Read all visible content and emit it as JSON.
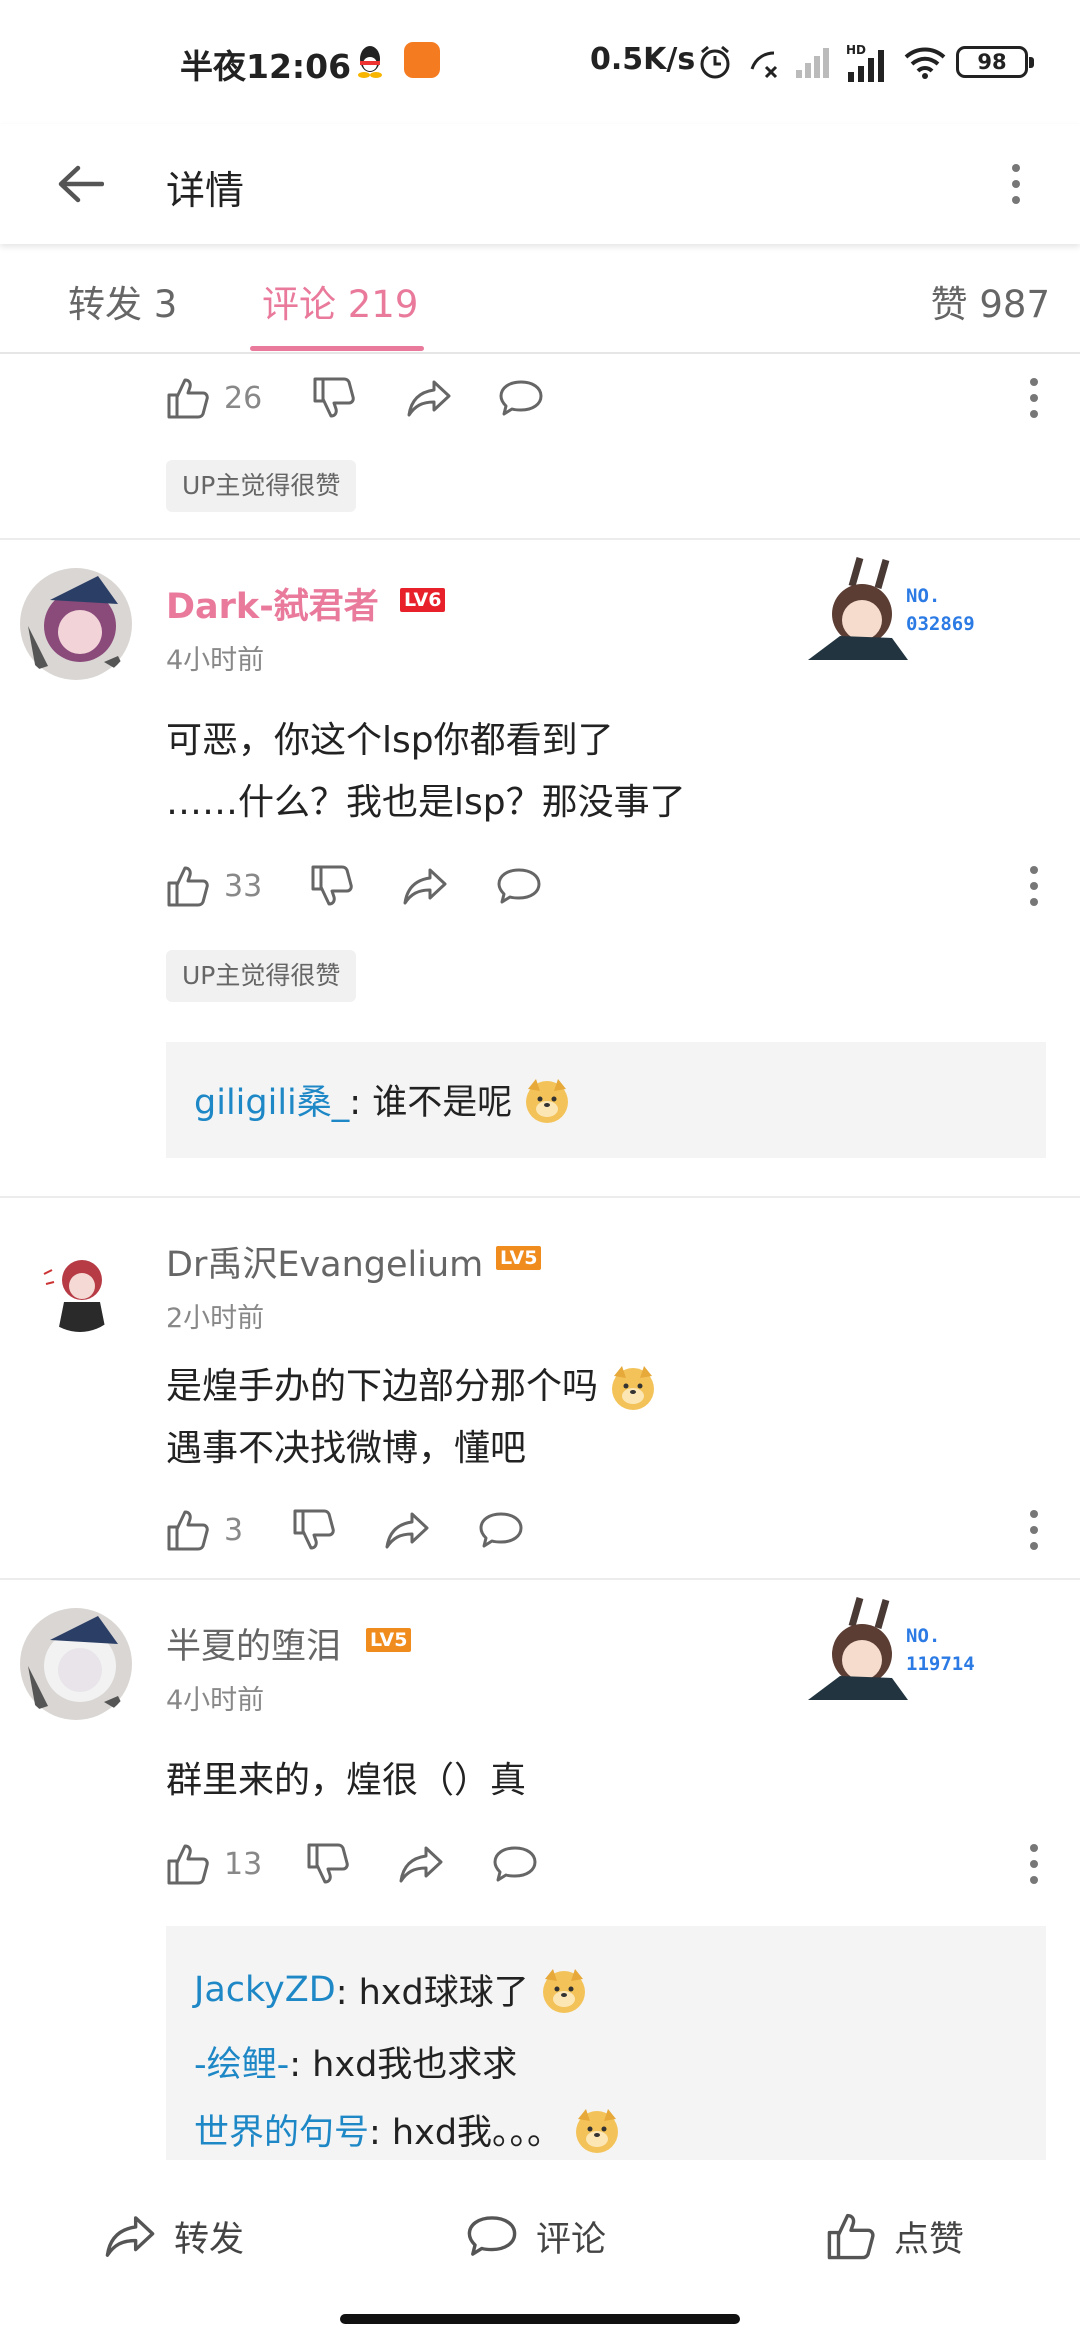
{
  "status_bar": {
    "time": "半夜12:06",
    "net_speed": "0.5K/s",
    "battery": "98",
    "icons": [
      "qq-icon",
      "app-icon",
      "alarm-icon",
      "call-off-icon",
      "signal-icon",
      "hd-signal-icon",
      "wifi-icon",
      "battery-icon"
    ]
  },
  "header": {
    "title": "详情"
  },
  "tabs": {
    "forward": "转发 3",
    "comment": "评论 219",
    "like": "赞 987"
  },
  "colors": {
    "accent_pink": "#e97a9c",
    "link_blue": "#1e88c7",
    "level_red": "#e8202a",
    "level_orange": "#f08c1e"
  },
  "top_partial": {
    "likes": "26",
    "up_liked": "UP主觉得很赞"
  },
  "comments": [
    {
      "user": "Dark-弑君者",
      "level": "LV6",
      "time": "4小时前",
      "badge_no": "NO.",
      "badge_id": "032869",
      "text_lines": [
        "可恶，你这个lsp你都看到了",
        "……什么？我也是lsp？那没事了"
      ],
      "likes": "33",
      "up_liked": "UP主觉得很赞",
      "replies": [
        {
          "name": "giligili桑_",
          "text": ": 谁不是呢"
        }
      ]
    },
    {
      "user": "Dr禹沢Evangelium",
      "level": "LV5",
      "time": "2小时前",
      "text_lines": [
        "是煌手办的下边部分那个吗",
        "遇事不决找微博，懂吧"
      ],
      "likes": "3"
    },
    {
      "user": "半夏的堕泪",
      "level": "LV5",
      "time": "4小时前",
      "badge_no": "NO.",
      "badge_id": "119714",
      "text_lines": [
        "群里来的，煌很（）真"
      ],
      "likes": "13",
      "replies": [
        {
          "name": "JackyZD",
          "text": ": hxd球球了"
        },
        {
          "name": "-绘鲤-",
          "text": ": hxd我也求求"
        },
        {
          "name": "世界的句号",
          "text": ": hxd我。。。"
        }
      ]
    }
  ],
  "bottom_bar": {
    "forward": "转发",
    "comment": "评论",
    "like": "点赞"
  }
}
